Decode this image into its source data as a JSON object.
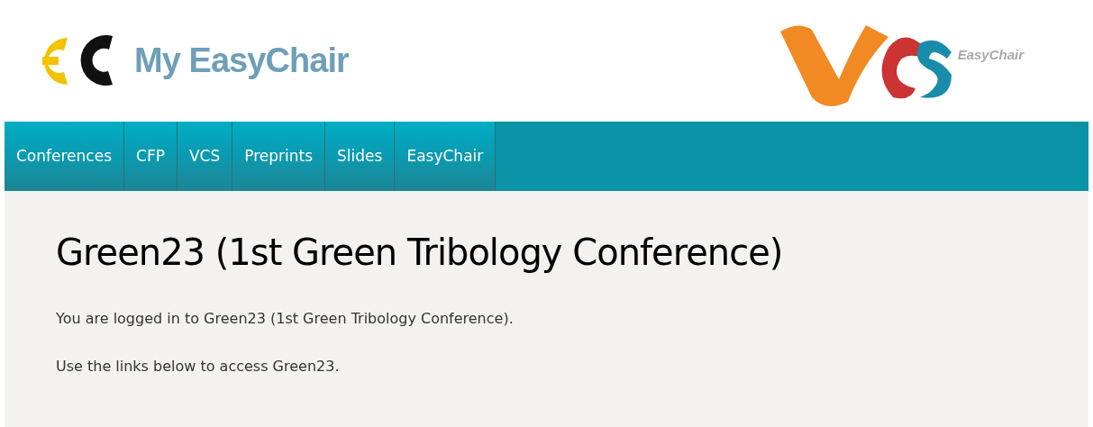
{
  "header": {
    "title": "My EasyChair",
    "vcs_logo_text": "EasyChair"
  },
  "nav": {
    "items": [
      {
        "label": "Conferences"
      },
      {
        "label": "CFP"
      },
      {
        "label": "VCS"
      },
      {
        "label": "Preprints"
      },
      {
        "label": "Slides"
      },
      {
        "label": "EasyChair"
      }
    ]
  },
  "content": {
    "heading": "Green23 (1st Green Tribology Conference)",
    "paragraphs": [
      "You are logged in to Green23 (1st Green Tribology Conference).",
      "Use the links below to access Green23."
    ]
  }
}
